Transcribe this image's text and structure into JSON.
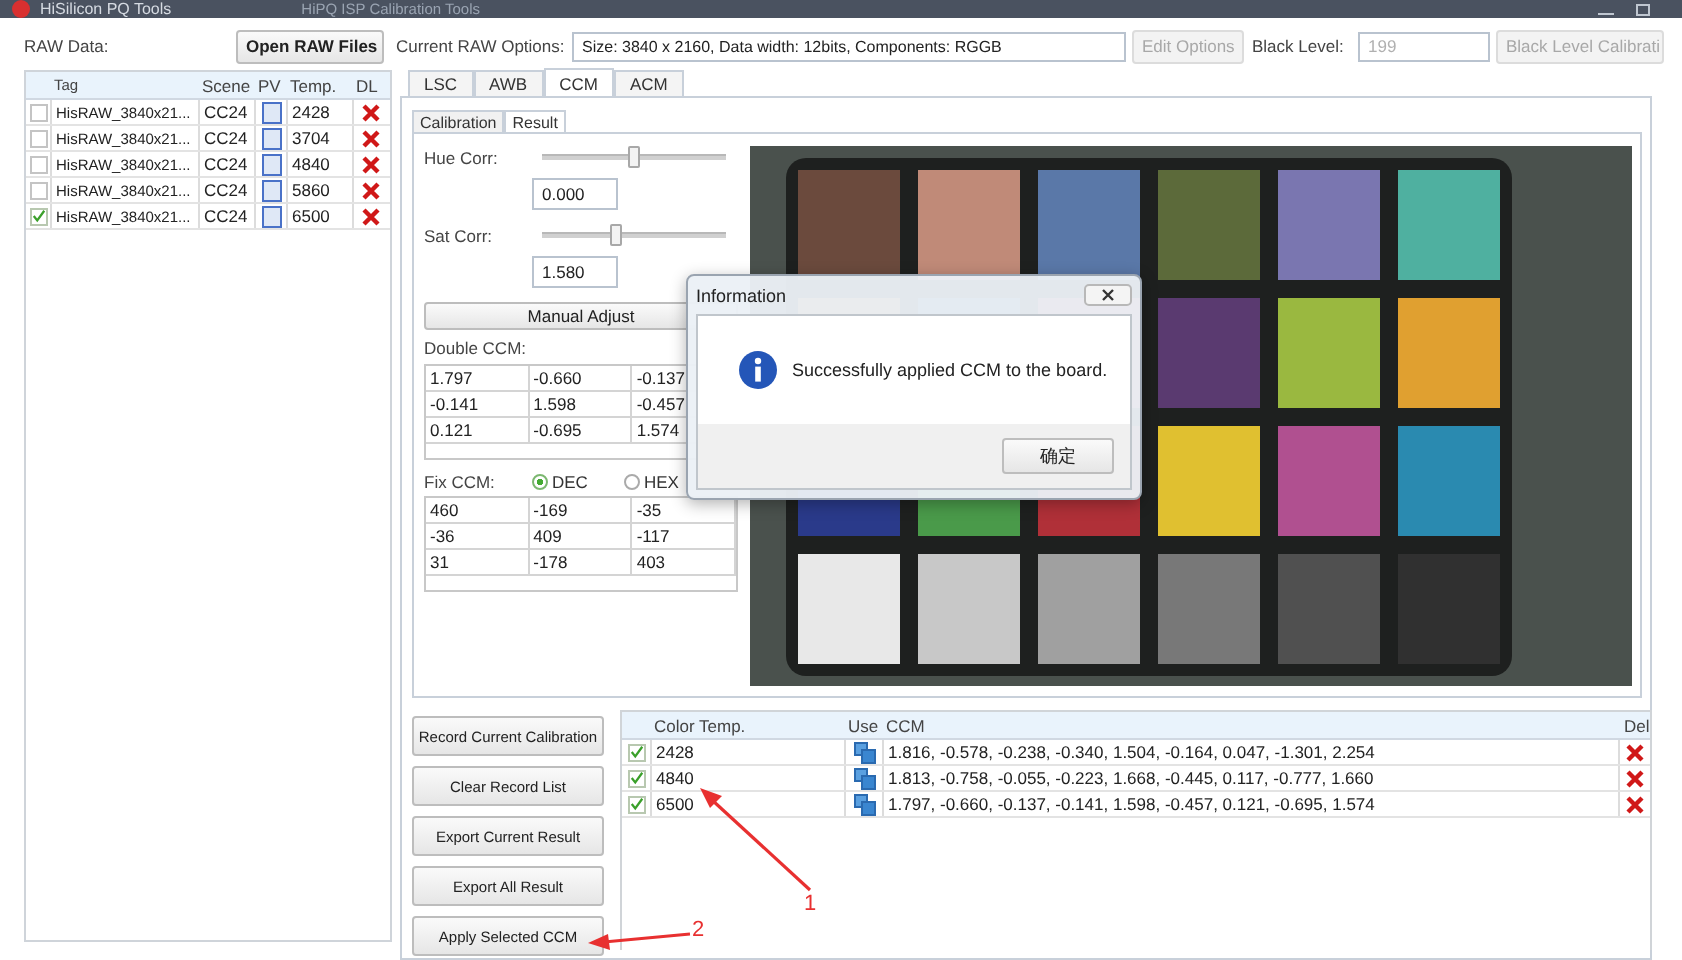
{
  "window": {
    "title": "HiSilicon PQ Tools",
    "subtitle": "HiPQ ISP Calibration Tools"
  },
  "toolbar": {
    "raw_data_label": "RAW Data:",
    "open_button": "Open RAW Files",
    "options_label": "Current RAW Options:",
    "options_value": "Size: 3840 x 2160, Data width: 12bits, Components: RGGB",
    "edit_button": {
      "label": "Edit Options",
      "disabled": true
    },
    "black_level_label": "Black Level:",
    "black_level_value": "199",
    "black_level_button": {
      "label": "Black Level Calibrati",
      "disabled": true
    }
  },
  "raw_table": {
    "columns": [
      "Tag",
      "Scene",
      "PV",
      "Temp.",
      "DL"
    ],
    "rows": [
      {
        "checked": false,
        "tag": "HisRAW_3840x21...",
        "scene": "CC24",
        "temp": "2428"
      },
      {
        "checked": false,
        "tag": "HisRAW_3840x21...",
        "scene": "CC24",
        "temp": "3704"
      },
      {
        "checked": false,
        "tag": "HisRAW_3840x21...",
        "scene": "CC24",
        "temp": "4840"
      },
      {
        "checked": false,
        "tag": "HisRAW_3840x21...",
        "scene": "CC24",
        "temp": "5860"
      },
      {
        "checked": true,
        "tag": "HisRAW_3840x21...",
        "scene": "CC24",
        "temp": "6500"
      }
    ]
  },
  "tabs": [
    {
      "label": "LSC",
      "selected": false
    },
    {
      "label": "AWB",
      "selected": false
    },
    {
      "label": "CCM",
      "selected": true
    },
    {
      "label": "ACM",
      "selected": false
    }
  ],
  "sub_tabs": [
    {
      "label": "Calibration",
      "selected": false
    },
    {
      "label": "Result",
      "selected": true
    }
  ],
  "result": {
    "hue": {
      "label": "Hue Corr:",
      "level": 0.49,
      "value": "0.000"
    },
    "sat": {
      "label": "Sat Corr:",
      "level": 0.39,
      "value": "1.580"
    },
    "manual_adjust": "Manual Adjust",
    "double_ccm": {
      "label": "Double CCM:",
      "rows": [
        [
          "1.797",
          "-0.660",
          "-0.137"
        ],
        [
          "-0.141",
          "1.598",
          "-0.457"
        ],
        [
          "0.121",
          "-0.695",
          "1.574"
        ]
      ]
    },
    "fix_ccm": {
      "label": "Fix CCM:",
      "formats": [
        {
          "label": "DEC",
          "selected": true
        },
        {
          "label": "HEX",
          "selected": false
        }
      ],
      "rows": [
        [
          "460",
          "-169",
          "-35"
        ],
        [
          "-36",
          "409",
          "-117"
        ],
        [
          "31",
          "-178",
          "403"
        ]
      ]
    }
  },
  "actions": [
    "Record Current Calibration",
    "Clear Record List",
    "Export Current Result",
    "Export All Result",
    "Apply Selected CCM"
  ],
  "record_table": {
    "columns": [
      "Color Temp.",
      "Use",
      "CCM",
      "Del"
    ],
    "rows": [
      {
        "checked": true,
        "temp": "2428",
        "ccm": "1.816, -0.578, -0.238, -0.340, 1.504, -0.164, 0.047, -1.301, 2.254"
      },
      {
        "checked": true,
        "temp": "4840",
        "ccm": "1.813, -0.758, -0.055, -0.223, 1.668, -0.445, 0.117, -0.777, 1.660"
      },
      {
        "checked": true,
        "temp": "6500",
        "ccm": "1.797, -0.660, -0.137, -0.141, 1.598, -0.457, 0.121, -0.695, 1.574"
      }
    ]
  },
  "dialog": {
    "title": "Information",
    "message": "Successfully applied CCM to the board.",
    "button": "确定"
  },
  "annotations": [
    {
      "label": "1"
    },
    {
      "label": "2"
    }
  ]
}
